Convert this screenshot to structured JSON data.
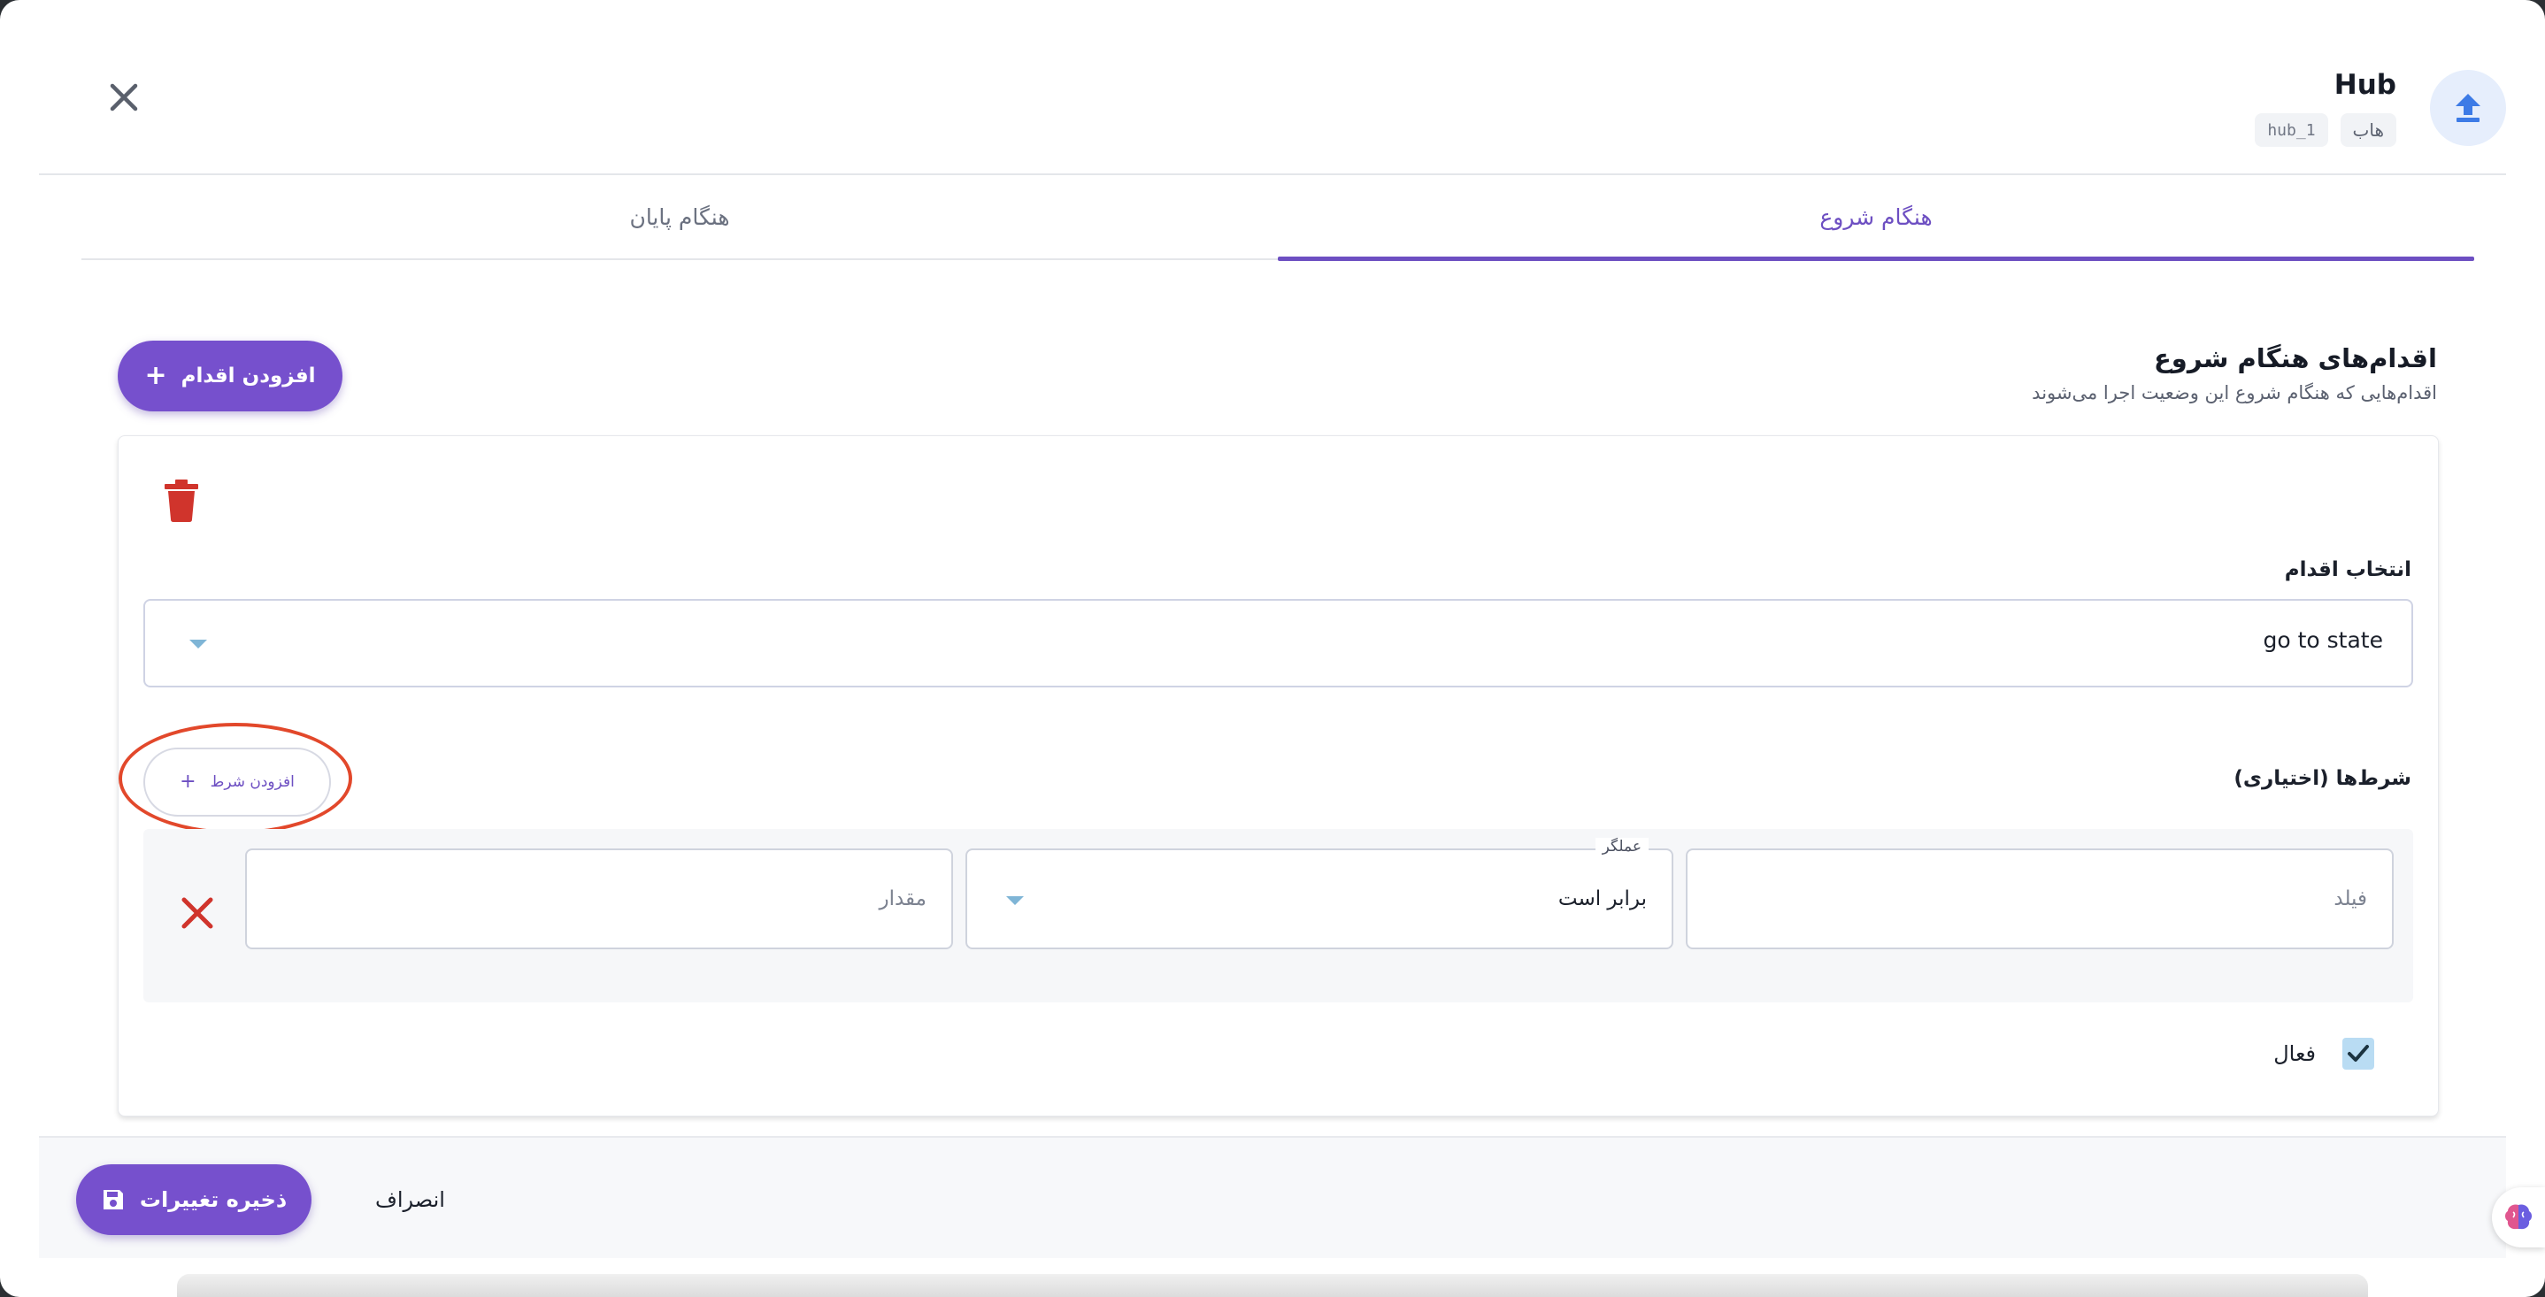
{
  "header": {
    "title": "Hub",
    "chips": [
      "هاب",
      "hub_1"
    ],
    "avatar_icon": "upload-icon",
    "close_icon": "close-icon"
  },
  "tabs": [
    {
      "label": "هنگام شروع",
      "active": true
    },
    {
      "label": "هنگام پایان",
      "active": false
    }
  ],
  "section": {
    "title": "اقدام‌های هنگام شروع",
    "subtitle": "اقدام‌هایی که هنگام شروع این وضعیت اجرا می‌شوند",
    "add_action_label": "افزودن اقدام"
  },
  "action_card": {
    "select_label": "انتخاب اقدام",
    "selected_action": "go to state",
    "conditions_label": "شرط‌ها (اختیاری)",
    "add_condition_label": "افزودن شرط",
    "condition": {
      "field_placeholder": "فیلد",
      "operator_label": "عملگر",
      "operator_value": "برابر است",
      "value_placeholder": "مقدار"
    },
    "active_label": "فعال",
    "active_checked": true
  },
  "footer": {
    "save_label": "ذخیره تغییرات",
    "cancel_label": "انصراف"
  },
  "colors": {
    "primary": "#7650cd",
    "tab_active": "#6d4fc2",
    "danger": "#d0342c",
    "highlight": "#e2482b",
    "checkbox": "#b9dcf3"
  }
}
